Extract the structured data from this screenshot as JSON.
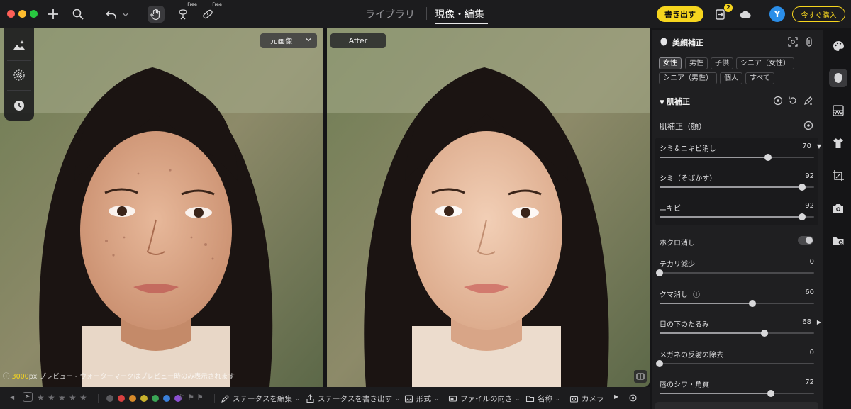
{
  "toolbar": {
    "free_label": "Free",
    "nav_tabs": [
      {
        "label": "ライブラリ",
        "active": false
      },
      {
        "label": "現像・編集",
        "active": true
      }
    ],
    "export_label": "書き出す",
    "notification_count": "2",
    "avatar_initial": "Y",
    "buy_label": "今すぐ購入"
  },
  "viewer": {
    "original_select": "元画像",
    "after_label": "After",
    "preview_res": "3000",
    "preview_note": "px プレビュー - ウォーターマークはプレビュー時のみ表示されます"
  },
  "bottombar": {
    "stars": 5,
    "color_labels": [
      "#d94040",
      "#d88a2a",
      "#c8b12c",
      "#3aa556",
      "#3a7fd9",
      "#8a4fd0"
    ],
    "items": [
      "ステータスを編集",
      "ステータスを書き出す",
      "形式",
      "ファイルの向き",
      "名称",
      "カメラ"
    ]
  },
  "panel": {
    "title": "美顔補正",
    "chips_row1": [
      {
        "label": "女性",
        "active": true
      },
      {
        "label": "男性",
        "active": false
      },
      {
        "label": "子供",
        "active": false
      },
      {
        "label": "シニア（女性）",
        "active": false
      }
    ],
    "chips_row2": [
      {
        "label": "シニア（男性）",
        "active": false
      },
      {
        "label": "個人",
        "active": false
      },
      {
        "label": "すべて",
        "active": false
      }
    ],
    "section_title": "肌補正",
    "sub_title": "肌補正（顔）",
    "group_sliders": [
      {
        "label": "シミ＆ニキビ消し",
        "value": 70,
        "suffix": "▼"
      },
      {
        "label": "シミ（そばかす）",
        "value": 92,
        "suffix": ""
      },
      {
        "label": "ニキビ",
        "value": 92,
        "suffix": ""
      }
    ],
    "mole_label": "ホクロ消し",
    "mole_on": false,
    "sliders": [
      {
        "label": "テカリ減少",
        "value": 0,
        "suffix": ""
      },
      {
        "label": "クマ消し",
        "value": 60,
        "suffix": "",
        "info": true
      },
      {
        "label": "目の下のたるみ",
        "value": 68,
        "suffix": "▶"
      },
      {
        "label": "メガネの反射の除去",
        "value": 0,
        "suffix": ""
      },
      {
        "label": "唇のシワ・角質",
        "value": 72,
        "suffix": ""
      }
    ]
  },
  "colors": {
    "accent": "#f6d51e",
    "avatar": "#2b8ee8",
    "panel_bg": "#1f1f21"
  }
}
